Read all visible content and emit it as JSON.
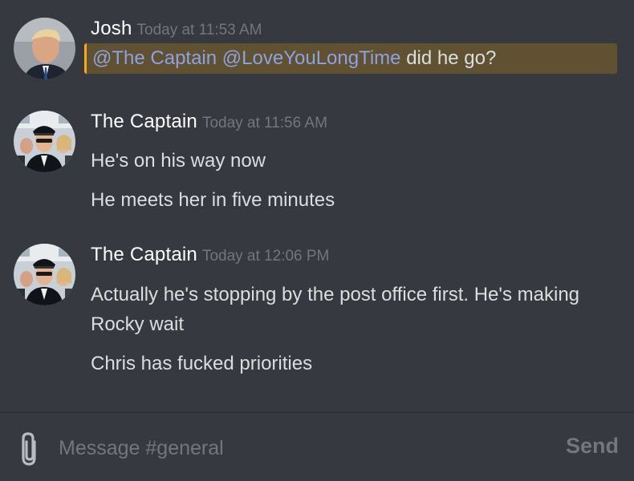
{
  "messages": [
    {
      "author": "Josh",
      "timestamp": "Today at 11:53 AM",
      "avatar_icon": "user-avatar-icon",
      "lines": [
        {
          "highlighted": true,
          "mention_1": "@The Captain",
          "mention_2": "@LoveYouLongTime",
          "text": "did he go?"
        }
      ]
    },
    {
      "author": "The Captain",
      "timestamp": "Today at 11:56 AM",
      "avatar_icon": "user-avatar-icon",
      "lines": [
        {
          "text": "He's on his way now"
        },
        {
          "text": "He meets her in five minutes"
        }
      ]
    },
    {
      "author": "The Captain",
      "timestamp": "Today at 12:06 PM",
      "avatar_icon": "user-avatar-icon",
      "lines": [
        {
          "text": "Actually he's stopping by the post office first. He's making Rocky wait"
        },
        {
          "text": "Chris has fucked priorities"
        }
      ]
    }
  ],
  "composer": {
    "placeholder": "Message #general",
    "value": "",
    "send_label": "Send",
    "attach_icon": "paperclip-icon"
  },
  "colors": {
    "background": "#36393f",
    "mention": "#8ea1e1",
    "highlight_bg": "#5f5131",
    "highlight_border": "#faa61a",
    "timestamp": "#72767d",
    "text": "#dcddde"
  }
}
